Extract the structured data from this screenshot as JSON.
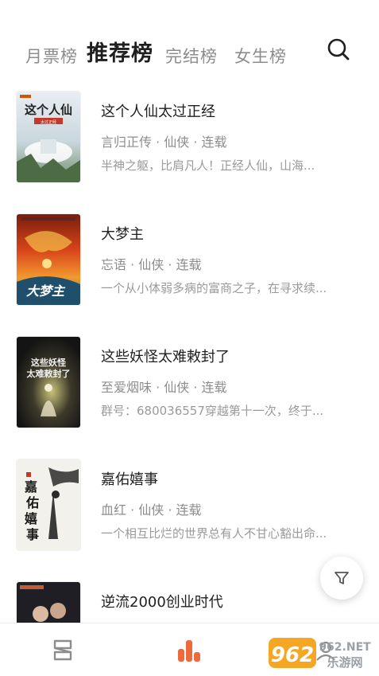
{
  "tabs": [
    {
      "label": "月票榜",
      "active": false
    },
    {
      "label": "推荐榜",
      "active": true
    },
    {
      "label": "完结榜",
      "active": false
    },
    {
      "label": "女生榜",
      "active": false
    }
  ],
  "search_icon": "search-icon",
  "books": [
    {
      "title": "这个人仙太过正经",
      "meta": "言归正传 · 仙侠 · 连载",
      "desc": "半神之躯，比肩凡人！正经人仙，山海...",
      "cover_text": "这个人仙"
    },
    {
      "title": "大梦主",
      "meta": "忘语 · 仙侠 · 连载",
      "desc": "一个从小体弱多病的富商之子，在寻求续...",
      "cover_text": "大梦主"
    },
    {
      "title": "这些妖怪太难敕封了",
      "meta": "至爱烟味 · 仙侠 · 连载",
      "desc": "群号：680036557穿越第十一次，终于...",
      "cover_text": "这些妖怪太难敕封了"
    },
    {
      "title": "嘉佑嬉事",
      "meta": "血红 · 仙侠 · 连载",
      "desc": "一个相互比烂的世界总有人不甘心豁出命...",
      "cover_text": "嘉佑嬉事"
    },
    {
      "title": "逆流2000创业时代",
      "meta": "",
      "desc": "",
      "cover_text": ""
    }
  ],
  "filter_icon": "filter-icon",
  "bottom_nav": [
    {
      "name": "bookshelf",
      "icon": "bookshelf-icon",
      "active": false
    },
    {
      "name": "rankings",
      "icon": "bar-chart-icon",
      "active": true
    },
    {
      "name": "profile",
      "icon": "profile-icon",
      "active": false
    }
  ],
  "watermark": {
    "top": "962.NET",
    "bottom": "乐游网"
  },
  "colors": {
    "accent": "#ee6a3a",
    "text_primary": "#1f1f1f",
    "text_secondary": "#8d8d8d"
  }
}
